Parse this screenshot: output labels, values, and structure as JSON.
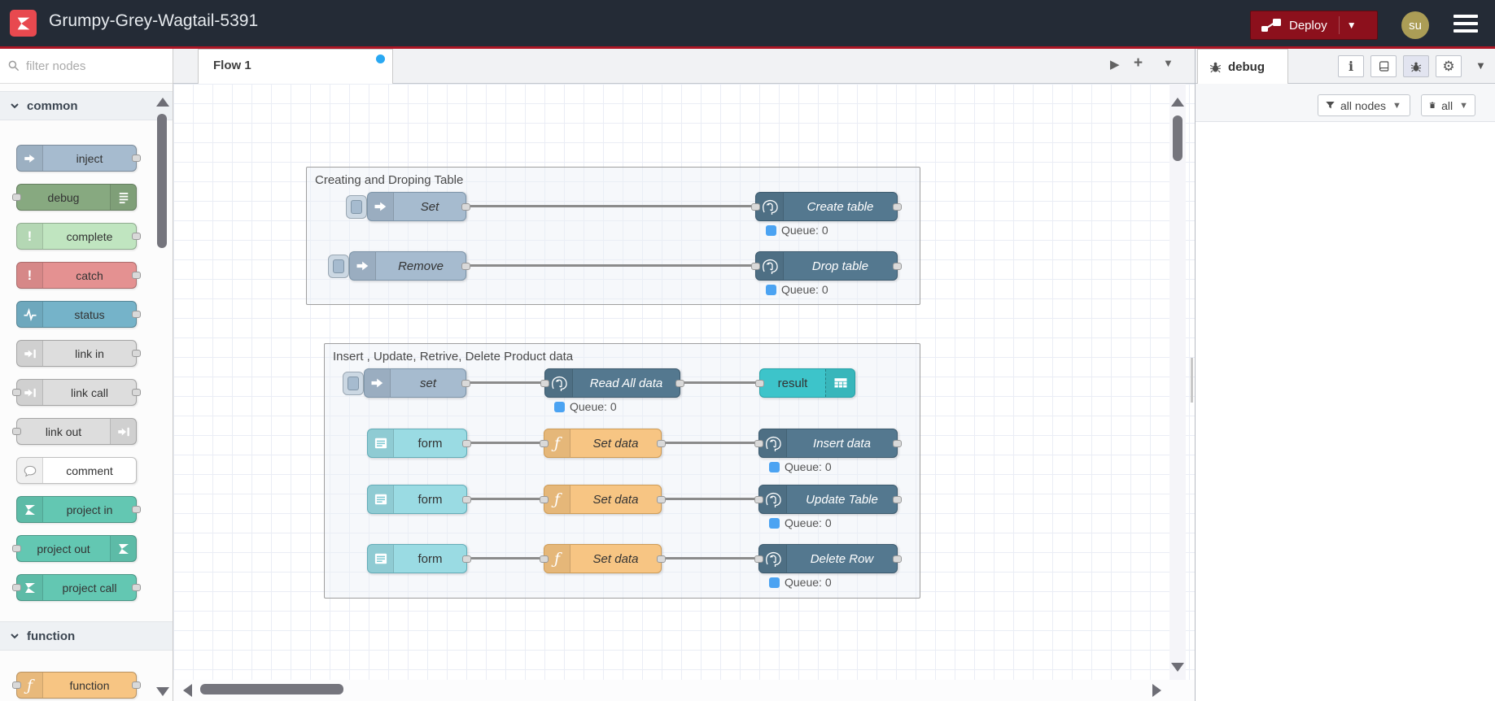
{
  "header": {
    "title": "Grumpy-Grey-Wagtail-5391",
    "deploy": {
      "label": "Deploy",
      "icon": "deploy-icon",
      "caret": "caret-down-icon"
    },
    "avatar": {
      "text": "su"
    },
    "menu_icon": "hamburger-icon",
    "colors": {
      "background": "#242b36",
      "accent_line": "#ad1625",
      "deploy_bg": "#8C101C",
      "avatar_bg": "#ab9d56",
      "logo_bg": "#e8494f"
    }
  },
  "palette": {
    "filter": {
      "placeholder": "filter nodes",
      "icon": "search-icon"
    },
    "categories": [
      {
        "label": "common",
        "nodes": [
          {
            "label": "inject",
            "color": "#a6bbcf",
            "icon": "inject-arrow-icon"
          },
          {
            "label": "debug",
            "color": "#87a980",
            "icon": "message-list-icon"
          },
          {
            "label": "complete",
            "color": "#c0e5c0",
            "icon": "exclamation-icon"
          },
          {
            "label": "catch",
            "color": "#e49191",
            "icon": "exclamation-icon"
          },
          {
            "label": "status",
            "color": "#75b3c9",
            "icon": "status-pulse-icon"
          },
          {
            "label": "link in",
            "color": "#dddddd",
            "icon": "link-icon"
          },
          {
            "label": "link call",
            "color": "#dddddd",
            "icon": "link-icon"
          },
          {
            "label": "link out",
            "color": "#dddddd",
            "icon": "link-icon"
          },
          {
            "label": "comment",
            "color": "#ffffff",
            "icon": "comment-bubble-icon"
          },
          {
            "label": "project in",
            "color": "#63c7b2",
            "icon": "node-red-icon"
          },
          {
            "label": "project out",
            "color": "#63c7b2",
            "icon": "node-red-icon"
          },
          {
            "label": "project call",
            "color": "#63c7b2",
            "icon": "node-red-icon"
          }
        ]
      },
      {
        "label": "function",
        "nodes": [
          {
            "label": "function",
            "color": "#f7c583",
            "icon": "function-icon"
          }
        ]
      }
    ]
  },
  "canvas": {
    "tab": {
      "label": "Flow 1",
      "status_dot_color": "#29a8f2"
    },
    "toolbar_icons": [
      "caret-right-icon",
      "plus-icon",
      "caret-down-icon"
    ],
    "groups": [
      {
        "title": "Creating and Droping Table"
      },
      {
        "title": "Insert , Update, Retrive, Delete Product data"
      }
    ],
    "nodes": {
      "set_caps": "Set",
      "create_table": "Create table",
      "remove": "Remove",
      "drop_table": "Drop table",
      "set_lower": "set",
      "read_all": "Read All data",
      "result": "result",
      "form": "form",
      "set_data": "Set data",
      "insert_data": "Insert data",
      "update_table": "Update Table",
      "delete_row": "Delete Row"
    },
    "status": {
      "queue": "Queue: 0",
      "dot_color": "#4ba3f2"
    },
    "node_colors": {
      "inject": "#a6bbcf",
      "postgresql": "#54788f",
      "function": "#f7c583",
      "form": "#9adbe3",
      "result": "#3dc4ca"
    }
  },
  "sidebar": {
    "tab": {
      "label": "debug",
      "icon": "debug-bug-icon"
    },
    "toolbar_icons": [
      "info-icon",
      "book-icon",
      "debug-bug-icon",
      "gear-icon",
      "caret-down-icon"
    ],
    "filter_nodes_button": {
      "label": "all nodes",
      "icon": "funnel-icon",
      "caret": "caret-down-icon"
    },
    "clear_button": {
      "label": "all",
      "icon": "trash-icon",
      "caret": "caret-down-icon"
    }
  }
}
